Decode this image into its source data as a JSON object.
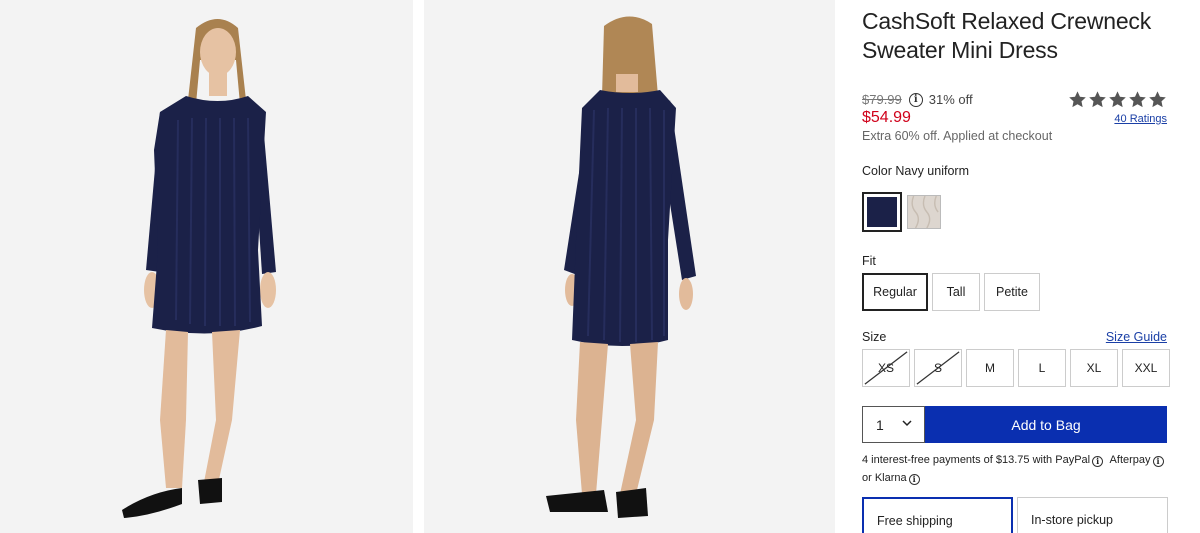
{
  "product": {
    "title": "CashSoft Relaxed Crewneck Sweater Mini Dress",
    "original_price": "$79.99",
    "discount": "31% off",
    "sale_price": "$54.99",
    "promo_text": "Extra 60% off. Applied at checkout",
    "rating": {
      "stars": 5,
      "filled": 5,
      "reviews_label": "40 Ratings"
    }
  },
  "color": {
    "label": "Color Navy uniform",
    "swatches": [
      {
        "name": "Navy uniform",
        "hex": "#1b2148",
        "selected": true
      },
      {
        "name": "Oatmeal",
        "hex": "#ddd6cf",
        "selected": false
      }
    ]
  },
  "fit": {
    "label": "Fit",
    "options": [
      {
        "label": "Regular",
        "selected": true
      },
      {
        "label": "Tall",
        "selected": false
      },
      {
        "label": "Petite",
        "selected": false
      }
    ]
  },
  "size": {
    "label": "Size",
    "guide_label": "Size Guide",
    "options": [
      {
        "label": "XS",
        "available": false
      },
      {
        "label": "S",
        "available": false
      },
      {
        "label": "M",
        "available": true
      },
      {
        "label": "L",
        "available": true
      },
      {
        "label": "XL",
        "available": true
      },
      {
        "label": "XXL",
        "available": true
      }
    ]
  },
  "cart": {
    "quantity": "1",
    "add_label": "Add to Bag"
  },
  "payment": {
    "text_1": "4 interest-free payments of $13.75 with",
    "paypal": "PayPal",
    "afterpay": "Afterpay",
    "or": "or",
    "klarna": "Klarna"
  },
  "shipping": {
    "options": [
      {
        "label": "Free shipping",
        "selected": true
      },
      {
        "label": "In-store pickup",
        "selected": false
      }
    ]
  },
  "colors": {
    "accent": "#0a2fb0",
    "sale": "#d0021b",
    "link": "#1a3fa6",
    "dress": "#1b2148"
  }
}
